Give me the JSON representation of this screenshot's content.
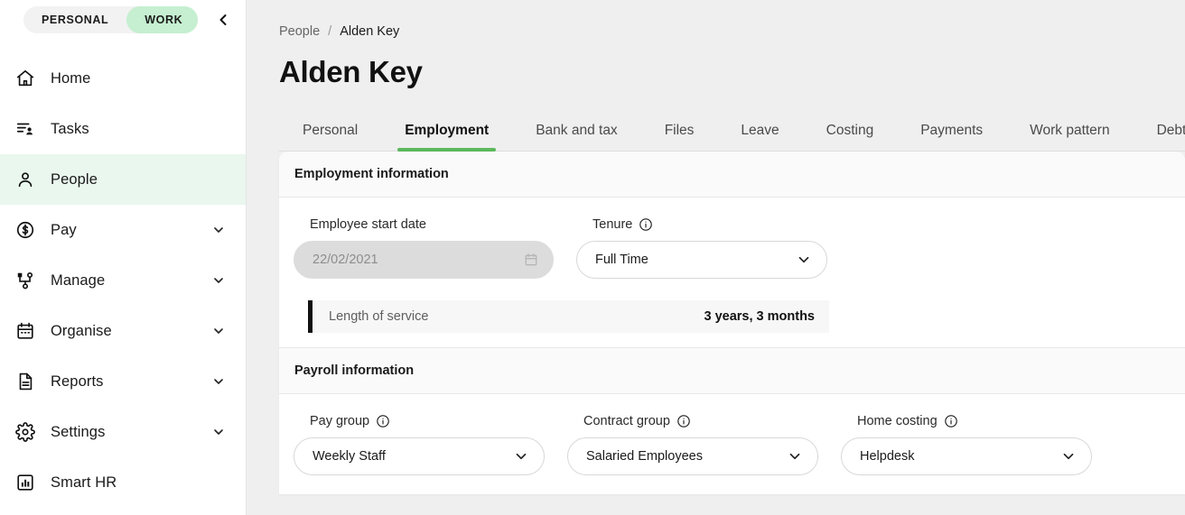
{
  "sidebar": {
    "toggle": {
      "personal_label": "PERSONAL",
      "work_label": "WORK",
      "active": "WORK",
      "active_color": "#c5efd0"
    },
    "collapse_icon": "chevron-left-icon",
    "items": [
      {
        "label": "Home",
        "icon": "home-icon",
        "expandable": false,
        "active": false
      },
      {
        "label": "Tasks",
        "icon": "tasks-icon",
        "expandable": false,
        "active": false
      },
      {
        "label": "People",
        "icon": "person-icon",
        "expandable": false,
        "active": true
      },
      {
        "label": "Pay",
        "icon": "dollar-circle-icon",
        "expandable": true,
        "active": false
      },
      {
        "label": "Manage",
        "icon": "org-chart-icon",
        "expandable": true,
        "active": false
      },
      {
        "label": "Organise",
        "icon": "calendar-icon",
        "expandable": true,
        "active": false
      },
      {
        "label": "Reports",
        "icon": "document-icon",
        "expandable": true,
        "active": false
      },
      {
        "label": "Settings",
        "icon": "gear-icon",
        "expandable": true,
        "active": false
      },
      {
        "label": "Smart HR",
        "icon": "bar-chart-icon",
        "expandable": false,
        "active": false
      }
    ],
    "active_item_bg": "#eaf7ee"
  },
  "breadcrumb": {
    "parent": "People",
    "separator": "/",
    "current": "Alden Key"
  },
  "page": {
    "title": "Alden Key"
  },
  "tabs": {
    "active": "Employment",
    "accent_color": "#5cb85c",
    "items": [
      {
        "label": "Personal"
      },
      {
        "label": "Employment"
      },
      {
        "label": "Bank and tax"
      },
      {
        "label": "Files"
      },
      {
        "label": "Leave"
      },
      {
        "label": "Costing"
      },
      {
        "label": "Payments"
      },
      {
        "label": "Work pattern"
      },
      {
        "label": "Debt"
      }
    ]
  },
  "employment_information": {
    "section_title": "Employment information",
    "start_date": {
      "label": "Employee start date",
      "value": "22/02/2021",
      "icon": "calendar-icon",
      "disabled": true
    },
    "tenure": {
      "label": "Tenure",
      "value": "Full Time",
      "info_icon": "info-icon",
      "chevron": "chevron-down-icon"
    },
    "length_of_service": {
      "label": "Length of service",
      "value": "3 years, 3 months"
    }
  },
  "payroll_information": {
    "section_title": "Payroll information",
    "fields": [
      {
        "label": "Pay group",
        "value": "Weekly Staff",
        "info_icon": "info-icon",
        "chevron": "chevron-down-icon"
      },
      {
        "label": "Contract group",
        "value": "Salaried Employees",
        "info_icon": "info-icon",
        "chevron": "chevron-down-icon"
      },
      {
        "label": "Home costing",
        "value": "Helpdesk",
        "info_icon": "info-icon",
        "chevron": "chevron-down-icon"
      }
    ]
  }
}
